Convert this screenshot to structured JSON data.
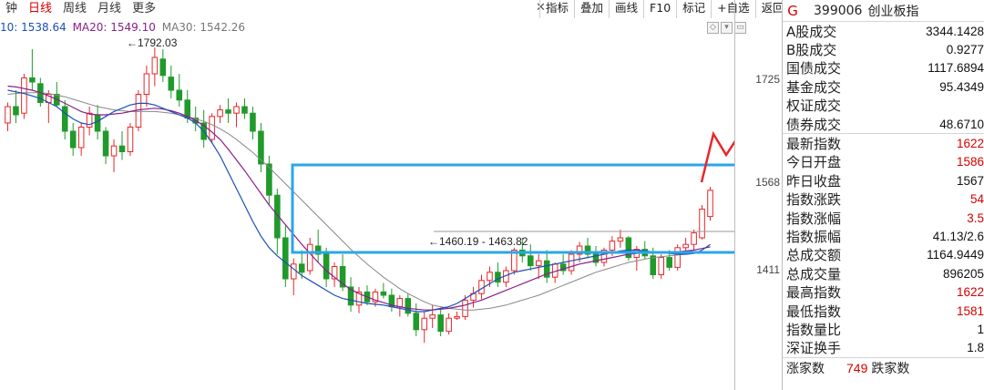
{
  "periods": [
    "钟",
    "日线",
    "周线",
    "月线",
    "更多"
  ],
  "active_period": 1,
  "toolbar": [
    "指标",
    "叠加",
    "画线",
    "F10",
    "标记",
    "+自选",
    "返回"
  ],
  "ma_legend": {
    "ma10": "10: 1538.64",
    "ma20": "MA20: 1549.10",
    "ma30": "MA30: 1542.26"
  },
  "chart_annotations": {
    "high": "1792.03",
    "low": "1460.19 - 1463.82"
  },
  "price_axis": [
    "1725",
    "1568",
    "1411"
  ],
  "colors": {
    "up": "#e8262a",
    "down": "#1f9a2b",
    "ma10": "#1c4fb8",
    "ma20": "#8a1f8a",
    "ma30": "#888888",
    "box": "#2ba6e8",
    "arrow": "#e8262a"
  },
  "info": {
    "badge": "G",
    "code": "399006",
    "name": "创业板指",
    "rows_a": [
      {
        "label": "A股成交",
        "value": "3344.1428"
      },
      {
        "label": "B股成交",
        "value": "0.9277"
      },
      {
        "label": "国债成交",
        "value": "1117.6894"
      },
      {
        "label": "基金成交",
        "value": "95.4349"
      },
      {
        "label": "权证成交",
        "value": ""
      },
      {
        "label": "债券成交",
        "value": "48.6710"
      }
    ],
    "rows_b": [
      {
        "label": "最新指数",
        "value": "1622",
        "red": true
      },
      {
        "label": "今日开盘",
        "value": "1586",
        "red": true
      },
      {
        "label": "昨日收盘",
        "value": "1567",
        "red": false
      },
      {
        "label": "指数涨跌",
        "value": "54",
        "red": true
      },
      {
        "label": "指数涨幅",
        "value": "3.5",
        "red": true
      },
      {
        "label": "指数振幅",
        "value": "41.13/2.6",
        "red": false
      },
      {
        "label": "总成交额",
        "value": "1164.9449",
        "red": false
      },
      {
        "label": "总成交量",
        "value": "896205",
        "red": false
      },
      {
        "label": "最高指数",
        "value": "1622",
        "red": true
      },
      {
        "label": "最低指数",
        "value": "1581",
        "red": true
      },
      {
        "label": "指数量比",
        "value": "1",
        "red": false
      },
      {
        "label": "深证换手",
        "value": "1.8",
        "red": false
      }
    ],
    "breadth": {
      "up_label": "涨家数",
      "up_count": "749",
      "down_label": "跌家数"
    }
  },
  "chart_data": {
    "type": "candlestick",
    "y_range": [
      1380,
      1800
    ],
    "candles": [
      [
        1700,
        1725,
        1690,
        1720
      ],
      [
        1720,
        1740,
        1700,
        1710
      ],
      [
        1712,
        1760,
        1705,
        1755
      ],
      [
        1755,
        1790,
        1740,
        1750
      ],
      [
        1748,
        1755,
        1720,
        1725
      ],
      [
        1725,
        1740,
        1700,
        1735
      ],
      [
        1735,
        1750,
        1720,
        1722
      ],
      [
        1720,
        1728,
        1680,
        1690
      ],
      [
        1690,
        1700,
        1660,
        1670
      ],
      [
        1670,
        1700,
        1660,
        1695
      ],
      [
        1695,
        1720,
        1685,
        1712
      ],
      [
        1710,
        1722,
        1680,
        1690
      ],
      [
        1690,
        1695,
        1650,
        1660
      ],
      [
        1660,
        1680,
        1640,
        1672
      ],
      [
        1672,
        1690,
        1655,
        1665
      ],
      [
        1665,
        1700,
        1660,
        1695
      ],
      [
        1695,
        1740,
        1690,
        1735
      ],
      [
        1735,
        1770,
        1720,
        1760
      ],
      [
        1760,
        1792,
        1745,
        1780
      ],
      [
        1778,
        1790,
        1750,
        1758
      ],
      [
        1756,
        1770,
        1730,
        1740
      ],
      [
        1740,
        1760,
        1720,
        1728
      ],
      [
        1728,
        1740,
        1700,
        1706
      ],
      [
        1706,
        1720,
        1690,
        1700
      ],
      [
        1700,
        1716,
        1670,
        1680
      ],
      [
        1680,
        1712,
        1675,
        1708
      ],
      [
        1708,
        1722,
        1700,
        1716
      ],
      [
        1716,
        1730,
        1700,
        1712
      ],
      [
        1712,
        1725,
        1695,
        1720
      ],
      [
        1720,
        1730,
        1705,
        1712
      ],
      [
        1712,
        1720,
        1680,
        1690
      ],
      [
        1690,
        1700,
        1640,
        1650
      ],
      [
        1650,
        1660,
        1600,
        1612
      ],
      [
        1612,
        1620,
        1540,
        1560
      ],
      [
        1560,
        1575,
        1500,
        1510
      ],
      [
        1510,
        1535,
        1490,
        1528
      ],
      [
        1528,
        1545,
        1510,
        1518
      ],
      [
        1520,
        1560,
        1515,
        1552
      ],
      [
        1550,
        1570,
        1530,
        1540
      ],
      [
        1540,
        1548,
        1500,
        1510
      ],
      [
        1510,
        1530,
        1500,
        1525
      ],
      [
        1525,
        1540,
        1495,
        1500
      ],
      [
        1500,
        1512,
        1470,
        1478
      ],
      [
        1478,
        1500,
        1468,
        1494
      ],
      [
        1494,
        1502,
        1478,
        1482
      ],
      [
        1482,
        1498,
        1476,
        1494
      ],
      [
        1494,
        1505,
        1486,
        1490
      ],
      [
        1490,
        1498,
        1470,
        1476
      ],
      [
        1476,
        1490,
        1464,
        1486
      ],
      [
        1486,
        1492,
        1464,
        1468
      ],
      [
        1468,
        1480,
        1440,
        1448
      ],
      [
        1448,
        1470,
        1432,
        1462
      ],
      [
        1462,
        1478,
        1450,
        1466
      ],
      [
        1466,
        1475,
        1440,
        1446
      ],
      [
        1446,
        1468,
        1442,
        1462
      ],
      [
        1462,
        1470,
        1460,
        1464
      ],
      [
        1464,
        1490,
        1460,
        1484
      ],
      [
        1484,
        1500,
        1475,
        1492
      ],
      [
        1492,
        1515,
        1485,
        1508
      ],
      [
        1508,
        1525,
        1500,
        1518
      ],
      [
        1518,
        1530,
        1500,
        1506
      ],
      [
        1506,
        1525,
        1500,
        1520
      ],
      [
        1520,
        1548,
        1515,
        1545
      ],
      [
        1545,
        1560,
        1530,
        1538
      ],
      [
        1538,
        1552,
        1520,
        1526
      ],
      [
        1526,
        1540,
        1510,
        1532
      ],
      [
        1532,
        1545,
        1505,
        1512
      ],
      [
        1512,
        1530,
        1505,
        1528
      ],
      [
        1528,
        1540,
        1515,
        1520
      ],
      [
        1520,
        1545,
        1515,
        1540
      ],
      [
        1540,
        1555,
        1530,
        1550
      ],
      [
        1550,
        1560,
        1535,
        1540
      ],
      [
        1540,
        1550,
        1525,
        1530
      ],
      [
        1530,
        1548,
        1525,
        1545
      ],
      [
        1545,
        1562,
        1538,
        1556
      ],
      [
        1556,
        1570,
        1548,
        1560
      ],
      [
        1560,
        1562,
        1532,
        1536
      ],
      [
        1536,
        1550,
        1520,
        1546
      ],
      [
        1546,
        1556,
        1534,
        1538
      ],
      [
        1538,
        1548,
        1510,
        1515
      ],
      [
        1515,
        1540,
        1510,
        1536
      ],
      [
        1536,
        1545,
        1520,
        1524
      ],
      [
        1524,
        1552,
        1520,
        1548
      ],
      [
        1548,
        1560,
        1540,
        1552
      ],
      [
        1552,
        1570,
        1545,
        1566
      ],
      [
        1560,
        1600,
        1558,
        1595
      ],
      [
        1586,
        1622,
        1581,
        1618
      ]
    ],
    "ma10": [
      1740,
      1738,
      1736,
      1733,
      1730,
      1725,
      1720,
      1712,
      1705,
      1700,
      1698,
      1702,
      1708,
      1714,
      1718,
      1722,
      1724,
      1724,
      1722,
      1718,
      1714,
      1710,
      1706,
      1700,
      1690,
      1676,
      1660,
      1640,
      1620,
      1600,
      1580,
      1562,
      1548,
      1538,
      1530,
      1522,
      1514,
      1508,
      1502,
      1496,
      1490,
      1486,
      1484,
      1482,
      1480,
      1479,
      1478,
      1476,
      1474,
      1472,
      1470,
      1470,
      1472,
      1474,
      1476,
      1480,
      1486,
      1492,
      1498,
      1504,
      1510,
      1514,
      1518,
      1520,
      1522,
      1524,
      1526,
      1528,
      1530,
      1532,
      1534,
      1536,
      1538,
      1540,
      1542,
      1544,
      1545,
      1545,
      1544,
      1543,
      1542,
      1541,
      1540,
      1540,
      1541,
      1545,
      1552
    ],
    "ma20": [
      1745,
      1744,
      1742,
      1740,
      1737,
      1733,
      1729,
      1724,
      1719,
      1714,
      1711,
      1710,
      1710,
      1711,
      1712,
      1714,
      1716,
      1717,
      1718,
      1717,
      1715,
      1712,
      1708,
      1703,
      1697,
      1689,
      1680,
      1668,
      1655,
      1642,
      1628,
      1614,
      1600,
      1588,
      1576,
      1564,
      1552,
      1541,
      1530,
      1520,
      1512,
      1504,
      1497,
      1492,
      1488,
      1484,
      1481,
      1478,
      1476,
      1474,
      1473,
      1472,
      1472,
      1473,
      1474,
      1476,
      1478,
      1481,
      1484,
      1488,
      1492,
      1496,
      1500,
      1504,
      1508,
      1512,
      1516,
      1519,
      1522,
      1525,
      1528,
      1530,
      1532,
      1534,
      1536,
      1538,
      1540,
      1541,
      1542,
      1542,
      1543,
      1543,
      1543,
      1544,
      1545,
      1547,
      1549
    ],
    "ma30": [
      1735,
      1736,
      1737,
      1737,
      1737,
      1736,
      1734,
      1732,
      1729,
      1726,
      1723,
      1720,
      1718,
      1716,
      1715,
      1714,
      1714,
      1714,
      1714,
      1713,
      1712,
      1710,
      1708,
      1705,
      1702,
      1698,
      1693,
      1687,
      1680,
      1672,
      1664,
      1655,
      1646,
      1636,
      1626,
      1616,
      1606,
      1596,
      1586,
      1576,
      1566,
      1556,
      1546,
      1537,
      1528,
      1520,
      1512,
      1505,
      1498,
      1492,
      1487,
      1482,
      1478,
      1476,
      1474,
      1473,
      1472,
      1472,
      1473,
      1474,
      1476,
      1478,
      1481,
      1484,
      1487,
      1490,
      1494,
      1498,
      1502,
      1506,
      1510,
      1514,
      1518,
      1521,
      1524,
      1527,
      1530,
      1532,
      1534,
      1536,
      1537,
      1538,
      1539,
      1540,
      1541,
      1542,
      1542
    ]
  }
}
